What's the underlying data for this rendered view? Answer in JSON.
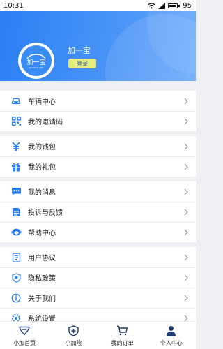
{
  "status_bar": {
    "time": "10:31",
    "battery": "95"
  },
  "profile": {
    "name": "加一宝",
    "login_label": "登录",
    "avatar_text": "加一宝",
    "avatar_sub": "JIAYIBAO.NET"
  },
  "menu": {
    "group1": [
      {
        "label": "车辆中心",
        "icon": "car-icon"
      },
      {
        "label": "我的邀请码",
        "icon": "qrcode-icon"
      }
    ],
    "group2": [
      {
        "label": "我的钱包",
        "icon": "wallet-icon"
      },
      {
        "label": "我的礼包",
        "icon": "gift-icon"
      }
    ],
    "group3": [
      {
        "label": "我的消息",
        "icon": "message-icon"
      },
      {
        "label": "投诉与反馈",
        "icon": "feedback-icon"
      },
      {
        "label": "帮助中心",
        "icon": "help-icon"
      }
    ],
    "group4": [
      {
        "label": "用户协议",
        "icon": "document-icon"
      },
      {
        "label": "隐私政策",
        "icon": "shield-icon"
      },
      {
        "label": "关于我们",
        "icon": "info-icon"
      },
      {
        "label": "系统设置",
        "icon": "settings-icon"
      }
    ]
  },
  "tabs": [
    {
      "label": "小加首页",
      "icon": "home-icon"
    },
    {
      "label": "小加险",
      "icon": "insurance-icon"
    },
    {
      "label": "我的订单",
      "icon": "cart-icon"
    },
    {
      "label": "个人中心",
      "icon": "profile-icon"
    }
  ],
  "colors": {
    "accent": "#2b7ff4",
    "login_bg": "#e2ee7d",
    "icon_blue": "#2a7ef0",
    "tab_navy": "#1e3b73"
  }
}
